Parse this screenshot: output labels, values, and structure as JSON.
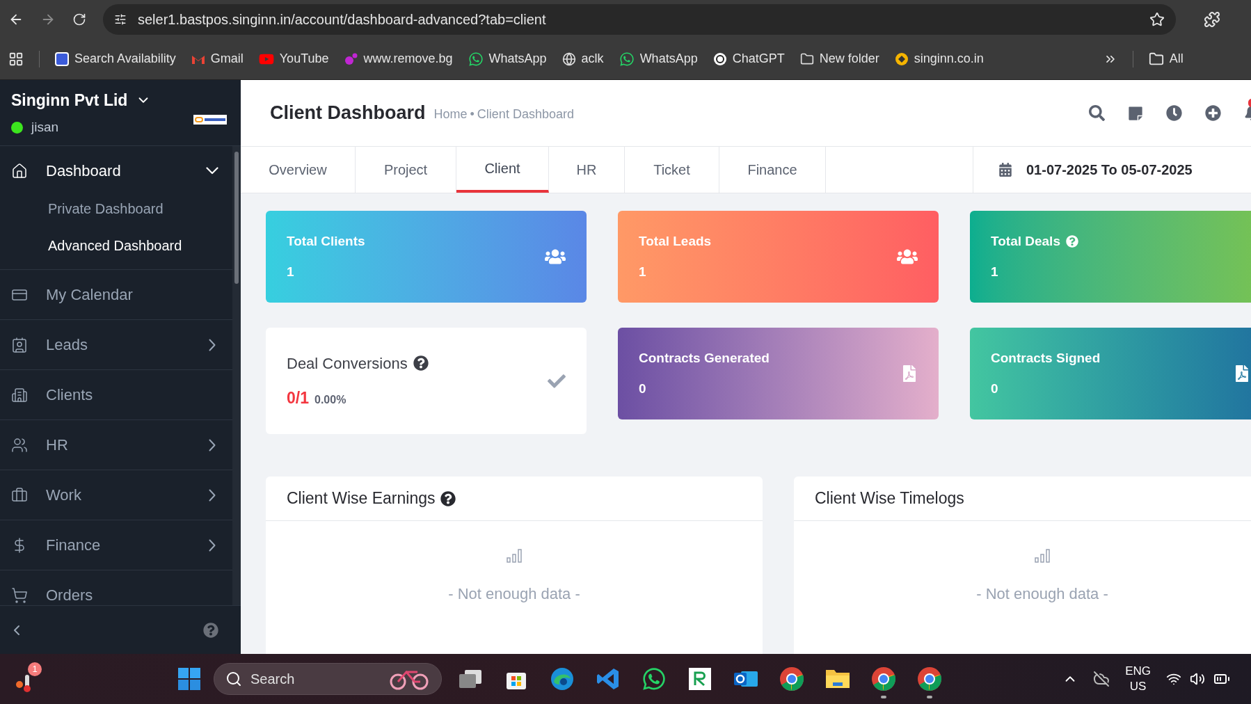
{
  "browser": {
    "url": "seler1.bastpos.singinn.in/account/dashboard-advanced?tab=client",
    "bookmarks": [
      {
        "label": "Search Availability",
        "kind": "app"
      },
      {
        "label": "Gmail",
        "kind": "gmail"
      },
      {
        "label": "YouTube",
        "kind": "youtube"
      },
      {
        "label": "www.remove.bg",
        "kind": "remove"
      },
      {
        "label": "WhatsApp",
        "kind": "whatsapp"
      },
      {
        "label": "aclk",
        "kind": "globe"
      },
      {
        "label": "WhatsApp",
        "kind": "whatsapp"
      },
      {
        "label": "ChatGPT",
        "kind": "chatgpt"
      },
      {
        "label": "New folder",
        "kind": "folder"
      },
      {
        "label": "singinn.co.in",
        "kind": "singinn"
      }
    ],
    "other_bookmarks": "All"
  },
  "sidebar": {
    "company": "Singinn Pvt Lid",
    "user": "jisan",
    "online": true,
    "items": [
      {
        "label": "Dashboard",
        "selected": true,
        "has_submenu": true,
        "expanded": true,
        "children": [
          {
            "label": "Private Dashboard",
            "selected": false
          },
          {
            "label": "Advanced Dashboard",
            "selected": true
          }
        ]
      },
      {
        "label": "My Calendar",
        "selected": false,
        "has_submenu": false
      },
      {
        "label": "Leads",
        "selected": false,
        "has_submenu": true,
        "expanded": false
      },
      {
        "label": "Clients",
        "selected": false,
        "has_submenu": false
      },
      {
        "label": "HR",
        "selected": false,
        "has_submenu": true,
        "expanded": false
      },
      {
        "label": "Work",
        "selected": false,
        "has_submenu": true,
        "expanded": false
      },
      {
        "label": "Finance",
        "selected": false,
        "has_submenu": true,
        "expanded": false
      },
      {
        "label": "Orders",
        "selected": false,
        "has_submenu": false
      }
    ]
  },
  "header": {
    "title": "Client Dashboard",
    "breadcrumb": {
      "items": [
        "Home",
        "Client Dashboard"
      ],
      "separator": "•"
    },
    "notification_badge": true
  },
  "tabs": [
    {
      "label": "Overview",
      "selected": false
    },
    {
      "label": "Project",
      "selected": false
    },
    {
      "label": "Client",
      "selected": true
    },
    {
      "label": "HR",
      "selected": false
    },
    {
      "label": "Ticket",
      "selected": false
    },
    {
      "label": "Finance",
      "selected": false
    }
  ],
  "date_range": "01-07-2025 To 05-07-2025",
  "cards": [
    {
      "kind": "stat",
      "title": "Total Clients",
      "value": "1",
      "help": false
    },
    {
      "kind": "stat",
      "title": "Total Leads",
      "value": "1",
      "help": false
    },
    {
      "kind": "stat",
      "title": "Total Deals",
      "value": "1",
      "help": true
    },
    {
      "kind": "ratio",
      "title": "Deal Conversions",
      "ratio": "0/1",
      "percent": "0.00%",
      "help": true
    },
    {
      "kind": "stat",
      "title": "Contracts Generated",
      "value": "0",
      "help": false
    },
    {
      "kind": "stat",
      "title": "Contracts Signed",
      "value": "0",
      "help": false
    }
  ],
  "panels": [
    {
      "title": "Client Wise Earnings",
      "help": true,
      "empty_text": "- Not enough data -"
    },
    {
      "title": "Client Wise Timelogs",
      "help": false,
      "empty_text": "- Not enough data -"
    }
  ],
  "taskbar": {
    "weather_badge": "1",
    "search_placeholder": "Search",
    "apps": [
      {
        "kind": "taskview",
        "running": false
      },
      {
        "kind": "store",
        "running": false
      },
      {
        "kind": "edge",
        "running": false
      },
      {
        "kind": "vscode",
        "running": false
      },
      {
        "kind": "whatsapp",
        "running": false
      },
      {
        "kind": "r-app",
        "running": false
      },
      {
        "kind": "outlook",
        "running": false
      },
      {
        "kind": "chrome",
        "running": false
      },
      {
        "kind": "files",
        "running": false
      },
      {
        "kind": "chrome",
        "running": true
      },
      {
        "kind": "chrome",
        "running": true
      }
    ],
    "language": "ENG",
    "region": "US"
  }
}
